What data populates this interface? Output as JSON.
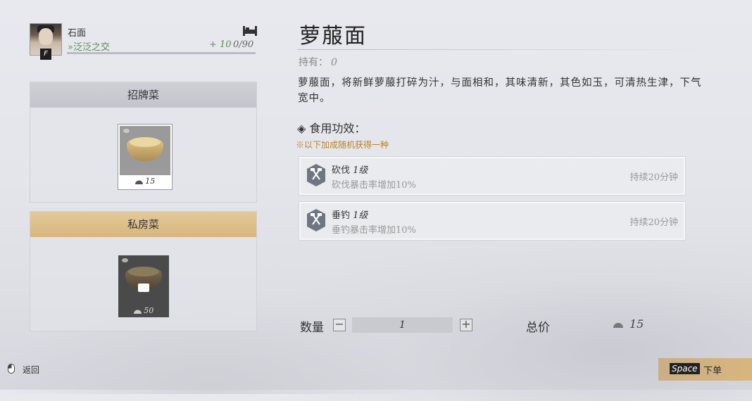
{
  "player": {
    "name": "石面",
    "relation": "»泛泛之交",
    "favor_gain": "+ 10",
    "favor": "0/90",
    "rank": "F"
  },
  "categories": [
    {
      "label": "招牌菜",
      "dish_price": "15"
    },
    {
      "label": "私房菜",
      "dish_price": "50"
    }
  ],
  "dish": {
    "name": "萝菔面",
    "owned_label": "持有：",
    "owned_value": "0",
    "description": "萝菔面，将新鲜萝菔打碎为汁，与面相和，其味清新，其色如玉，可清热生津，下气宽中。"
  },
  "effects": {
    "heading": "◈ 食用功效：",
    "note": "※以下加成随机获得一种",
    "buffs": [
      {
        "skill": "砍伐",
        "level": "1级",
        "desc": "砍伐暴击率增加10%",
        "duration": "持续20分钟",
        "icon": "axe-icon"
      },
      {
        "skill": "垂钓",
        "level": "1级",
        "desc": "垂钓暴击率增加10%",
        "duration": "持续20分钟",
        "icon": "fishing-icon"
      }
    ]
  },
  "order": {
    "qty_label": "数量",
    "minus": "−",
    "plus": "+",
    "qty": "1",
    "total_label": "总价",
    "total": "15"
  },
  "footer": {
    "back_label": "返回",
    "order_key": "Space",
    "order_label": "下单"
  },
  "colors": {
    "relation_green": "#5b8a56",
    "note_orange": "#b9822e",
    "accent_gold": "#d8b67d"
  }
}
